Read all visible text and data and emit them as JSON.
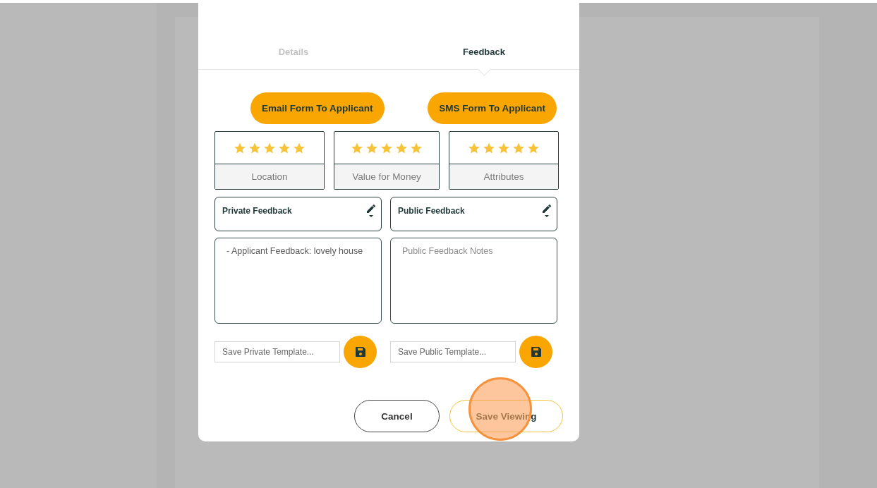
{
  "tabs": [
    {
      "label": "Details",
      "selected": false
    },
    {
      "label": "Feedback",
      "selected": true
    }
  ],
  "send_buttons": [
    "Email Form To Applicant",
    "SMS Form To Applicant"
  ],
  "ratings": [
    {
      "label": "Location",
      "stars": 5
    },
    {
      "label": "Value for Money",
      "stars": 5
    },
    {
      "label": "Attributes",
      "stars": 5
    }
  ],
  "feedback_panels": [
    {
      "title": "Private Feedback",
      "notes_value": "- Applicant Feedback: lovely house",
      "template_placeholder": "Save Private Template..."
    },
    {
      "title": "Public Feedback",
      "notes_placeholder": "Public Feedback Notes",
      "template_placeholder": "Save Public Template..."
    }
  ],
  "footer": {
    "cancel": "Cancel",
    "save": "Save Viewing"
  }
}
